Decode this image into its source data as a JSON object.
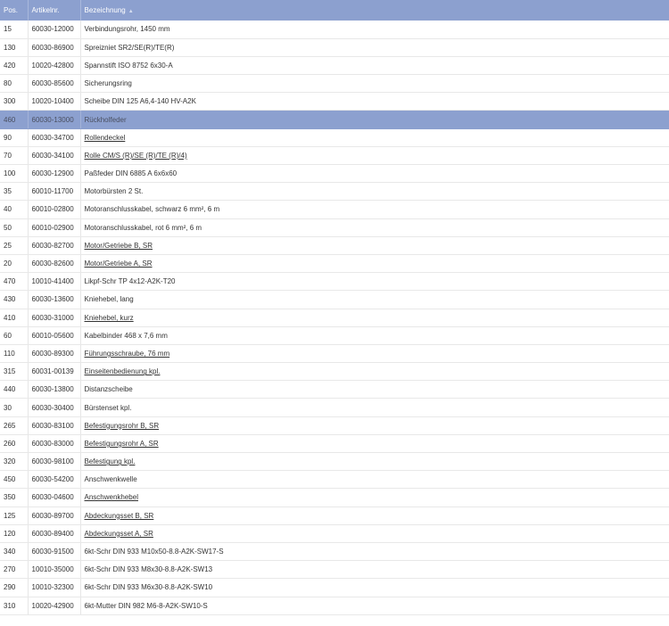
{
  "table": {
    "headers": {
      "pos": "Pos.",
      "artikelnr": "Artikelnr.",
      "bezeichnung": "Bezeichnung"
    },
    "sorted_column_icon": "sort-arrow-icon",
    "selected_row_index": 5,
    "rows": [
      {
        "pos": "15",
        "artikelnr": "60030-12000",
        "bezeichnung": "Verbindungsrohr, 1450 mm",
        "link": false
      },
      {
        "pos": "130",
        "artikelnr": "60030-86900",
        "bezeichnung": "Spreizniet SR2/SE(R)/TE(R)",
        "link": false
      },
      {
        "pos": "420",
        "artikelnr": "10020-42800",
        "bezeichnung": "Spannstift ISO 8752 6x30-A",
        "link": false
      },
      {
        "pos": "80",
        "artikelnr": "60030-85600",
        "bezeichnung": "Sicherungsring",
        "link": false
      },
      {
        "pos": "300",
        "artikelnr": "10020-10400",
        "bezeichnung": "Scheibe DIN 125 A6,4-140 HV-A2K",
        "link": false
      },
      {
        "pos": "460",
        "artikelnr": "60030-13000",
        "bezeichnung": "Rückholfeder",
        "link": false
      },
      {
        "pos": "90",
        "artikelnr": "60030-34700",
        "bezeichnung": "Rollendeckel",
        "link": true
      },
      {
        "pos": "70",
        "artikelnr": "60030-34100",
        "bezeichnung": "Rolle CM/S (R)/SE (R)/TE (R)/4)",
        "link": true
      },
      {
        "pos": "100",
        "artikelnr": "60030-12900",
        "bezeichnung": "Paßfeder DIN 6885 A 6x6x60",
        "link": false
      },
      {
        "pos": "35",
        "artikelnr": "60010-11700",
        "bezeichnung": "Motorbürsten 2 St.",
        "link": false
      },
      {
        "pos": "40",
        "artikelnr": "60010-02800",
        "bezeichnung": "Motoranschlusskabel, schwarz 6 mm², 6 m",
        "link": false
      },
      {
        "pos": "50",
        "artikelnr": "60010-02900",
        "bezeichnung": "Motoranschlusskabel, rot 6 mm², 6 m",
        "link": false
      },
      {
        "pos": "25",
        "artikelnr": "60030-82700",
        "bezeichnung": "Motor/Getriebe B, SR",
        "link": true
      },
      {
        "pos": "20",
        "artikelnr": "60030-82600",
        "bezeichnung": "Motor/Getriebe A, SR",
        "link": true
      },
      {
        "pos": "470",
        "artikelnr": "10010-41400",
        "bezeichnung": "Likpf-Schr TP 4x12-A2K-T20",
        "link": false
      },
      {
        "pos": "430",
        "artikelnr": "60030-13600",
        "bezeichnung": "Kniehebel, lang",
        "link": false
      },
      {
        "pos": "410",
        "artikelnr": "60030-31000",
        "bezeichnung": "Kniehebel, kurz",
        "link": true
      },
      {
        "pos": "60",
        "artikelnr": "60010-05600",
        "bezeichnung": "Kabelbinder 468 x 7,6 mm",
        "link": false
      },
      {
        "pos": "110",
        "artikelnr": "60030-89300",
        "bezeichnung": "Führungsschraube, 76 mm",
        "link": true
      },
      {
        "pos": "315",
        "artikelnr": "60031-00139",
        "bezeichnung": "Einseitenbedienung kpl.",
        "link": true
      },
      {
        "pos": "440",
        "artikelnr": "60030-13800",
        "bezeichnung": "Distanzscheibe",
        "link": false
      },
      {
        "pos": "30",
        "artikelnr": "60030-30400",
        "bezeichnung": "Bürstenset kpl.",
        "link": false
      },
      {
        "pos": "265",
        "artikelnr": "60030-83100",
        "bezeichnung": "Befestigungsrohr B, SR",
        "link": true
      },
      {
        "pos": "260",
        "artikelnr": "60030-83000",
        "bezeichnung": "Befestigungsrohr A, SR",
        "link": true
      },
      {
        "pos": "320",
        "artikelnr": "60030-98100",
        "bezeichnung": "Befestigung kpl.",
        "link": true
      },
      {
        "pos": "450",
        "artikelnr": "60030-54200",
        "bezeichnung": "Anschwenkwelle",
        "link": false
      },
      {
        "pos": "350",
        "artikelnr": "60030-04600",
        "bezeichnung": "Anschwenkhebel",
        "link": true
      },
      {
        "pos": "125",
        "artikelnr": "60030-89700",
        "bezeichnung": "Abdeckungsset B, SR",
        "link": true
      },
      {
        "pos": "120",
        "artikelnr": "60030-89400",
        "bezeichnung": "Abdeckungsset A, SR",
        "link": true
      },
      {
        "pos": "340",
        "artikelnr": "60030-91500",
        "bezeichnung": "6kt-Schr DIN 933 M10x50-8.8-A2K-SW17-S",
        "link": false
      },
      {
        "pos": "270",
        "artikelnr": "10010-35000",
        "bezeichnung": "6kt-Schr DIN 933 M8x30-8.8-A2K-SW13",
        "link": false
      },
      {
        "pos": "290",
        "artikelnr": "10010-32300",
        "bezeichnung": "6kt-Schr DIN 933 M6x30-8.8-A2K-SW10",
        "link": false
      },
      {
        "pos": "310",
        "artikelnr": "10020-42900",
        "bezeichnung": "6kt-Mutter DIN 982 M6-8-A2K-SW10-S",
        "link": false
      }
    ]
  }
}
